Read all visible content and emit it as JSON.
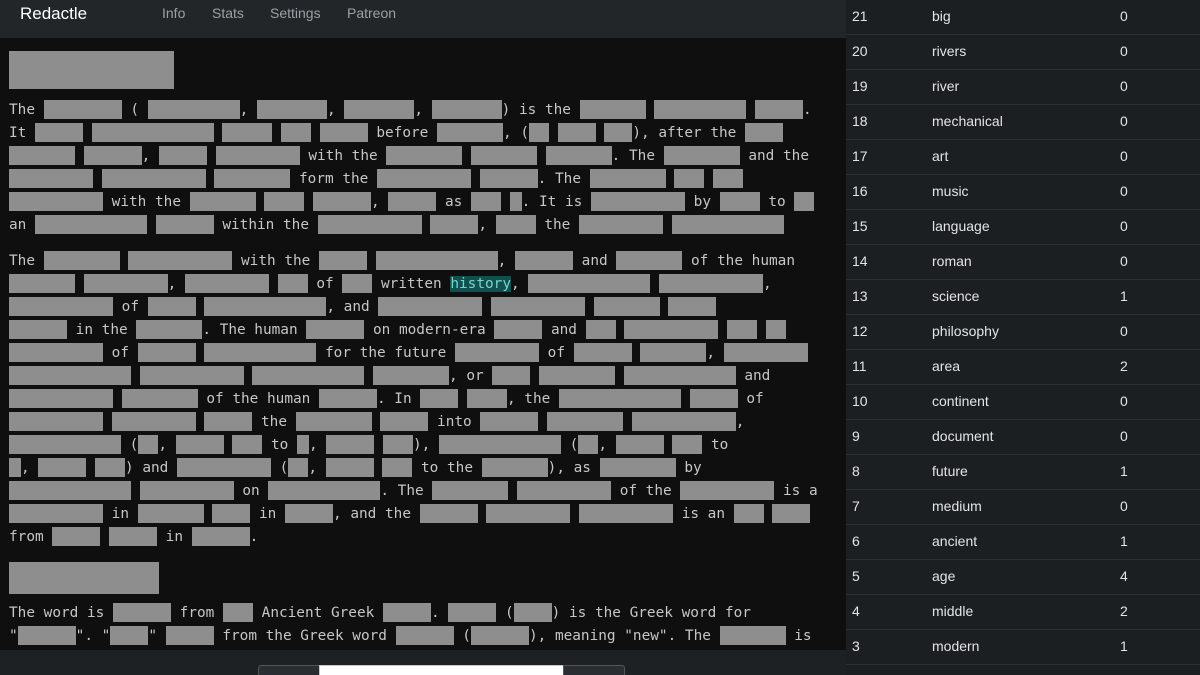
{
  "navbar": {
    "brand": "Redactle",
    "links": [
      "Info",
      "Stats",
      "Settings",
      "Patreon"
    ]
  },
  "article": {
    "highlight_word": "history",
    "p1": {
      "w_the": "The",
      "w_is_the": ") is the",
      "w_it": "It",
      "w_before": "before",
      "w_after_the": "), after the",
      "w_with_the": "with the",
      "w_the2": ". The",
      "w_and_the": "and the",
      "w_form_the": "form the",
      "w_the3": ". The",
      "w_with_the2": "with the",
      "w_as": "as",
      "w_it_is": ". It is",
      "w_by": "by",
      "w_to": "to",
      "w_an": "an",
      "w_within_the": "within the",
      "w_the4": "the"
    },
    "p2": {
      "w_the": "The",
      "w_with_the": "with the",
      "w_and": "and",
      "w_of_the_human": "of the human",
      "w_of": "of",
      "w_written": "written",
      "w_of2": "of",
      "w_and2": ", and",
      "w_in_the": "in the",
      "w_the_human": ". The human",
      "w_on_modern_era": "on modern-era",
      "w_and3": "and",
      "w_of3": "of",
      "w_for_the_future": "for the future",
      "w_of4": "of",
      "w_or": ", or",
      "w_and4": "and",
      "w_of_the_human2": "of the human",
      "w_in": ". In",
      "w_the2": ", the",
      "w_of5": "of",
      "w_the3": "the",
      "w_into": "into",
      "w_to": "to",
      "w_to2": "to",
      "w_and5": ") and",
      "w_to_the": "to the",
      "w_as": "), as",
      "w_by": "by",
      "w_on": "on",
      "w_the4": ". The",
      "w_of_the": "of the",
      "w_is_a": "is a",
      "w_in2": "in",
      "w_in3": "in",
      "w_and_the": ", and the",
      "w_is_an": "is an",
      "w_from": "from",
      "w_in4": "in"
    },
    "p3": {
      "w_the_word_is": "The word is",
      "w_from": "from",
      "w_ancient_greek": "Ancient Greek",
      "w_is_greek_word_for": ") is the Greek word for",
      "w_from_greek_word": "from the Greek word",
      "w_meaning_new": "), meaning \"new\". The",
      "w_is": "is"
    }
  },
  "guesses": {
    "rows": [
      {
        "num": "21",
        "word": "big",
        "hits": "0"
      },
      {
        "num": "20",
        "word": "rivers",
        "hits": "0"
      },
      {
        "num": "19",
        "word": "river",
        "hits": "0"
      },
      {
        "num": "18",
        "word": "mechanical",
        "hits": "0"
      },
      {
        "num": "17",
        "word": "art",
        "hits": "0"
      },
      {
        "num": "16",
        "word": "music",
        "hits": "0"
      },
      {
        "num": "15",
        "word": "language",
        "hits": "0"
      },
      {
        "num": "14",
        "word": "roman",
        "hits": "0"
      },
      {
        "num": "13",
        "word": "science",
        "hits": "1"
      },
      {
        "num": "12",
        "word": "philosophy",
        "hits": "0"
      },
      {
        "num": "11",
        "word": "area",
        "hits": "2"
      },
      {
        "num": "10",
        "word": "continent",
        "hits": "0"
      },
      {
        "num": "9",
        "word": "document",
        "hits": "0"
      },
      {
        "num": "8",
        "word": "future",
        "hits": "1"
      },
      {
        "num": "7",
        "word": "medium",
        "hits": "0"
      },
      {
        "num": "6",
        "word": "ancient",
        "hits": "1"
      },
      {
        "num": "5",
        "word": "age",
        "hits": "4"
      },
      {
        "num": "4",
        "word": "middle",
        "hits": "2"
      },
      {
        "num": "3",
        "word": "modern",
        "hits": "1"
      }
    ]
  }
}
